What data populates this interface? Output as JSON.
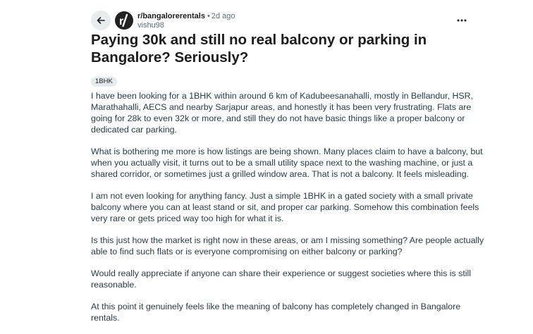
{
  "header": {
    "subreddit": "r/bangalorerentals",
    "separator": "•",
    "time": "2d ago",
    "author": "vishu98",
    "avatar_icon": "reddit-community-icon",
    "back_icon": "arrow-left-icon",
    "more_icon": "ellipsis-icon"
  },
  "post": {
    "title": "Paying 30k and still no real balcony or parking in Bangalore? Seriously?",
    "flair": "1BHK",
    "paragraphs": [
      "I have been looking for a 1BHK within around 6 km of Kadubeesanahalli, mostly in Bellandur, HSR, Marathahalli, AECS and nearby Sarjapur areas, and honestly it has been very frustrating. Flats are going for 28k to even 32k or more, and still they do not have basic things like a proper balcony or dedicated car parking.",
      "What is bothering me more is how listings are being shown. Many places claim to have a balcony, but when you actually visit, it turns out to be a small utility space next to the washing machine, or just a shared corridor, or sometimes just a grilled window area. That is not a balcony. It feels misleading.",
      "I am not even looking for anything fancy. Just a simple 1BHK in a gated society with a small private balcony where you can at least stand or sit, and proper car parking. Somehow this combination feels very rare or gets priced way too high for what it is.",
      "Is this just how the market is right now in these areas, or am I missing something? Are people actually able to find such flats or is everyone compromising on either balcony or parking?",
      "Would really appreciate if anyone can share their experience or suggest societies where this is still reasonable.",
      "At this point it genuinely feels like the meaning of balcony has completely changed in Bangalore rentals."
    ]
  },
  "colors": {
    "text": "#1c1c1c",
    "body_text": "#2a3c42",
    "muted": "#576f76",
    "button_bg": "#e9eced",
    "flair_bg": "#e5ebee",
    "avatar_bg": "#222222"
  }
}
